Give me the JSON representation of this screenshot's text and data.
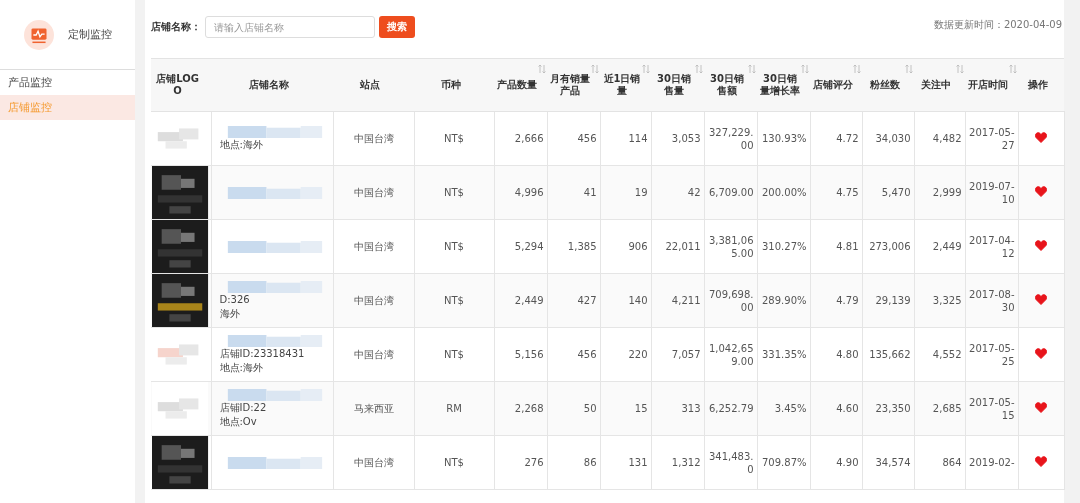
{
  "sidebar": {
    "title": "定制监控",
    "items": [
      {
        "label": "产品监控",
        "selected": false
      },
      {
        "label": "店铺监控",
        "selected": true
      }
    ]
  },
  "search": {
    "label": "店铺名称：",
    "placeholder": "请输入店铺名称",
    "button": "搜索"
  },
  "update_time": "数据更新时间：2020-04-09",
  "table": {
    "columns": [
      {
        "label": "店铺LOGO",
        "sortable": false
      },
      {
        "label": "店铺名称",
        "sortable": false
      },
      {
        "label": "站点",
        "sortable": false
      },
      {
        "label": "币种",
        "sortable": false
      },
      {
        "label": "产品数量",
        "sortable": true
      },
      {
        "label": "月有销量产品",
        "sortable": true
      },
      {
        "label": "近1日销量",
        "sortable": true
      },
      {
        "label": "30日销售量",
        "sortable": true
      },
      {
        "label": "30日销售额",
        "sortable": true
      },
      {
        "label": "30日销量增长率",
        "sortable": true
      },
      {
        "label": "店铺评分",
        "sortable": true
      },
      {
        "label": "粉丝数",
        "sortable": true
      },
      {
        "label": "关注中",
        "sortable": true
      },
      {
        "label": "开店时间",
        "sortable": true
      },
      {
        "label": "操作",
        "sortable": false
      }
    ],
    "rows": [
      {
        "name_lines": [
          "地点:海外"
        ],
        "site": "中国台湾",
        "currency": "NT$",
        "values": [
          "2,666",
          "456",
          "114",
          "3,053",
          "327,229.00",
          "130.93%",
          "4.72",
          "34,030",
          "4,482",
          "2017-05-27"
        ],
        "favorited": true
      },
      {
        "site": "中国台湾",
        "currency": "NT$",
        "values": [
          "4,996",
          "41",
          "19",
          "42",
          "6,709.00",
          "200.00%",
          "4.75",
          "5,470",
          "2,999",
          "2019-07-10"
        ],
        "favorited": true
      },
      {
        "site": "中国台湾",
        "currency": "NT$",
        "values": [
          "5,294",
          "1,385",
          "906",
          "22,011",
          "3,381,065.00",
          "310.27%",
          "4.81",
          "273,006",
          "2,449",
          "2017-04-12"
        ],
        "favorited": true
      },
      {
        "name_lines": [
          "D:326",
          "海外"
        ],
        "site": "中国台湾",
        "currency": "NT$",
        "values": [
          "2,449",
          "427",
          "140",
          "4,211",
          "709,698.00",
          "289.90%",
          "4.79",
          "29,139",
          "3,325",
          "2017-08-30"
        ],
        "favorited": true
      },
      {
        "name_lines": [
          "店铺ID:23318431",
          "地点:海外"
        ],
        "site": "中国台湾",
        "currency": "NT$",
        "values": [
          "5,156",
          "456",
          "220",
          "7,057",
          "1,042,659.00",
          "331.35%",
          "4.80",
          "135,662",
          "4,552",
          "2017-05-25"
        ],
        "favorited": true
      },
      {
        "name_lines": [
          "店铺ID:22",
          "地点:Ov"
        ],
        "site": "马来西亚",
        "currency": "RM",
        "values": [
          "2,268",
          "50",
          "15",
          "313",
          "6,252.79",
          "3.45%",
          "4.60",
          "23,350",
          "2,685",
          "2017-05-15"
        ],
        "favorited": true
      },
      {
        "site": "中国台湾",
        "currency": "NT$",
        "values": [
          "276",
          "86",
          "131",
          "1,312",
          "341,483.0",
          "709.87%",
          "4.90",
          "34,574",
          "864",
          "2019-02-"
        ],
        "favorited": true
      }
    ]
  }
}
